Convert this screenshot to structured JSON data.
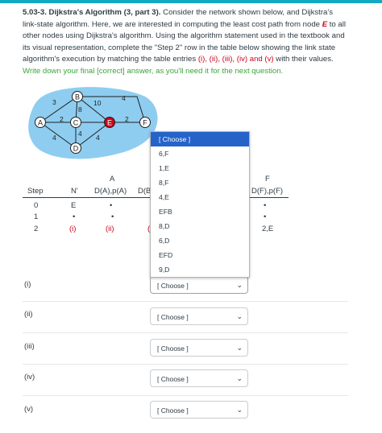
{
  "question": {
    "title": "5.03-3. Dijkstra's Algorithm (3, part 3).",
    "t1": " Consider the network shown below, and Dijkstra's link-state algorithm.  Here, we are interested in computing the least cost path from node ",
    "node": "E",
    "t2": " to all other nodes using Dijkstra's algorithm. Using the algorithm statement used in the textbook and its visual representation, complete the \"Step 2\" row in the table below showing the link state algorithm's execution by matching the table entries ",
    "entries": "(i), (ii), (iii), (iv) and (v)",
    "t3": " with their values.  ",
    "note": "Write down your final [correct] answer, as you'll need it for the next question."
  },
  "graph": {
    "nodes": [
      "A",
      "B",
      "C",
      "D",
      "E",
      "F"
    ],
    "edge_weights": [
      "3",
      "10",
      "8",
      "4",
      "2",
      "2",
      "4",
      "4",
      "4"
    ],
    "colors": {
      "cloud": "#8ecdf0",
      "source": "#d0021b"
    }
  },
  "table": {
    "headers": {
      "step": "Step",
      "n": "N'",
      "a_top": "A",
      "a": "D(A),p(A)",
      "b_partial": "D(B",
      "f_top": "F",
      "f": "D(F),p(F)"
    },
    "rows": [
      {
        "step": "0",
        "n": "E",
        "a": "•",
        "f": "•"
      },
      {
        "step": "1",
        "n": "•",
        "a": "•",
        "f": "•"
      },
      {
        "step": "2",
        "n": "(i)",
        "a": "(ii)",
        "b_partial": "(",
        "f": "2,E"
      }
    ]
  },
  "dropdown": {
    "options": [
      "[ Choose ]",
      "6,F",
      "1,E",
      "8,F",
      "4,E",
      "EFB",
      "8,D",
      "6,D",
      "EFD",
      "9,D"
    ],
    "selected": "[ Choose ]"
  },
  "answers": [
    {
      "label": "(i)",
      "value": "[ Choose ]"
    },
    {
      "label": "(ii)",
      "value": "[ Choose ]"
    },
    {
      "label": "(iii)",
      "value": "[ Choose ]"
    },
    {
      "label": "(iv)",
      "value": "[ Choose ]"
    },
    {
      "label": "(v)",
      "value": "[ Choose ]"
    }
  ]
}
